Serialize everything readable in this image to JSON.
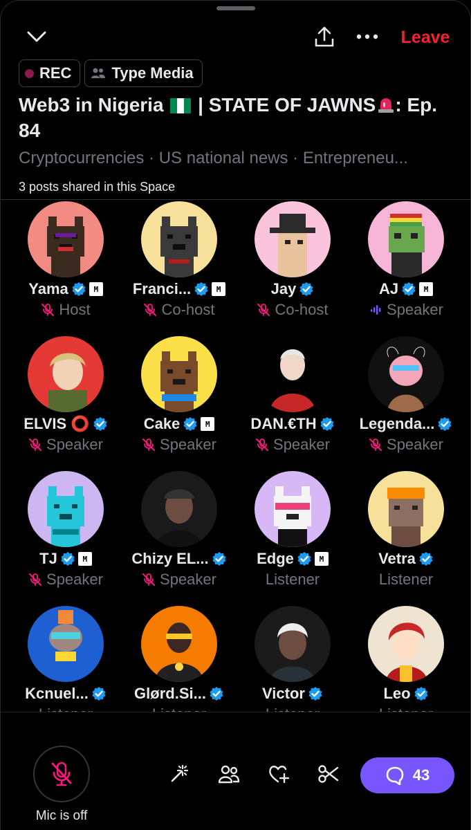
{
  "header": {
    "leave_label": "Leave",
    "chips": [
      "REC",
      "Type Media"
    ],
    "title_part1": "Web3 in Nigeria",
    "title_part2": " | STATE OF JAWNS",
    "title_part3": ": Ep. 84",
    "topics": "Cryptocurrencies · US national news · Entrepreneu...",
    "posts_shared": "3 posts shared in this Space"
  },
  "participants": [
    {
      "name": "Yama",
      "role": "Host",
      "verified": true,
      "mbadge": true,
      "muted": true,
      "avatar": "dog-red",
      "bg": "#f28b82"
    },
    {
      "name": "Franci...",
      "role": "Co-host",
      "verified": true,
      "mbadge": true,
      "muted": true,
      "avatar": "cat-black",
      "bg": "#f6e09a"
    },
    {
      "name": "Jay",
      "role": "Co-host",
      "verified": true,
      "mbadge": false,
      "muted": true,
      "avatar": "cowboy",
      "bg": "#f9c4dc"
    },
    {
      "name": "AJ",
      "role": "Speaker",
      "verified": true,
      "mbadge": true,
      "muted": false,
      "avatar": "frog",
      "bg": "#f7b6d8"
    },
    {
      "name": "ELVIS ⭕",
      "role": "Speaker",
      "verified": true,
      "mbadge": false,
      "muted": true,
      "avatar": "man-blond",
      "bg": "#e53935"
    },
    {
      "name": "Cake",
      "role": "Speaker",
      "verified": true,
      "mbadge": true,
      "muted": true,
      "avatar": "dog-brown",
      "bg": "#fbe049"
    },
    {
      "name": "DAN.€TH",
      "role": "Speaker",
      "verified": true,
      "mbadge": false,
      "muted": true,
      "avatar": "man-white",
      "bg": "#000000"
    },
    {
      "name": "Legenda...",
      "role": "Speaker",
      "verified": true,
      "mbadge": false,
      "muted": true,
      "avatar": "goat",
      "bg": "#111111"
    },
    {
      "name": "TJ",
      "role": "Speaker",
      "verified": true,
      "mbadge": true,
      "muted": true,
      "avatar": "cat-teal",
      "bg": "#cdb6f2"
    },
    {
      "name": "Chizy EL...",
      "role": "Speaker",
      "verified": true,
      "mbadge": false,
      "muted": true,
      "avatar": "man-cap",
      "bg": "#1a1a1a"
    },
    {
      "name": "Edge",
      "role": "Listener",
      "verified": true,
      "mbadge": true,
      "muted": false,
      "avatar": "cat-white",
      "bg": "#d7b8f7"
    },
    {
      "name": "Vetra",
      "role": "Listener",
      "verified": true,
      "mbadge": false,
      "muted": false,
      "avatar": "dog-hardhat",
      "bg": "#f6e09a"
    },
    {
      "name": "Kcnuel...",
      "role": "Listener",
      "verified": true,
      "mbadge": false,
      "muted": false,
      "avatar": "dog-blue",
      "bg": "#1e5fd1"
    },
    {
      "name": "Glørd.Si...",
      "role": "Listener",
      "verified": true,
      "mbadge": false,
      "muted": false,
      "avatar": "man-orange",
      "bg": "#f57c00"
    },
    {
      "name": "Victor",
      "role": "Listener",
      "verified": true,
      "mbadge": false,
      "muted": false,
      "avatar": "man-braids",
      "bg": "#1b1b1b"
    },
    {
      "name": "Leo",
      "role": "Listener",
      "verified": true,
      "mbadge": false,
      "muted": false,
      "avatar": "anime-red",
      "bg": "#efe4d2"
    }
  ],
  "footer": {
    "mic_label": "Mic is off",
    "comment_count": "43"
  },
  "colors": {
    "accent": "#7856ff",
    "leave": "#f4212e",
    "muted_icon": "#f91880",
    "verified": "#1d9bf0",
    "secondary_text": "#71767b"
  }
}
